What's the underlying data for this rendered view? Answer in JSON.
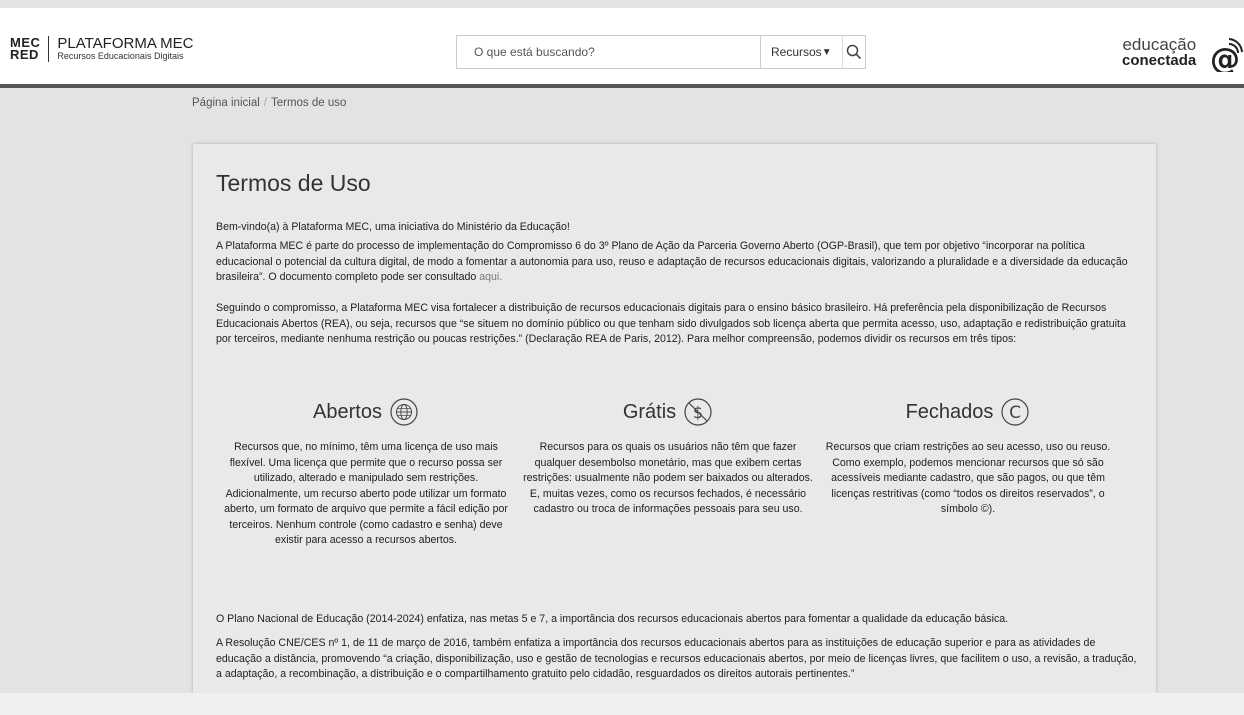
{
  "header": {
    "logo_mark_top": "MEC",
    "logo_mark_bottom": "RED",
    "logo_title": "PLATAFORMA MEC",
    "logo_subtitle": "Recursos Educacionais Digitais",
    "search": {
      "placeholder": "O que está buscando?",
      "category": "Recursos"
    },
    "brand_line1": "educação",
    "brand_line2": "conectada"
  },
  "breadcrumb": {
    "home": "Página inicial",
    "separator": "/",
    "current": "Termos de uso"
  },
  "page": {
    "title": "Termos de Uso",
    "p1": "Bem-vindo(a) à Plataforma MEC, uma iniciativa do Ministério da Educação!",
    "p2": "A Plataforma MEC é parte do processo de implementação do Compromisso 6 do 3º Plano de Ação da Parceria Governo Aberto (OGP-Brasil), que tem por objetivo “incorporar na política educacional o potencial da cultura digital, de modo a fomentar a autonomia para uso, reuso e adaptação de recursos educacionais digitais, valorizando a pluralidade e a diversidade da educação brasileira”. O documento completo pode ser consultado",
    "p2_link": "aqui.",
    "p3": "Seguindo o compromisso, a Plataforma MEC visa fortalecer a distribuição de recursos educacionais digitais para o ensino básico brasileiro. Há preferência pela disponibilização de Recursos Educacionais Abertos (REA), ou seja, recursos que “se situem no domínio público ou que tenham sido divulgados sob licença aberta que permita acesso, uso, adaptação e redistribuição gratuita por terceiros, mediante nenhuma restrição ou poucas restrições.” (Declaração REA de Paris, 2012). Para melhor compreensão, podemos dividir os recursos em três tipos:",
    "types": [
      {
        "title": "Abertos",
        "icon": "globe-icon",
        "text": "Recursos que, no mínimo, têm uma licença de uso mais flexível. Uma licença que permite que o recurso possa ser utilizado, alterado e manipulado sem restrições. Adicionalmente, um recurso aberto pode utilizar um formato aberto, um formato de arquivo que permite a fácil edição por terceiros. Nenhum controle (como cadastro e senha) deve existir para acesso a recursos abertos."
      },
      {
        "title": "Grátis",
        "icon": "no-dollar-icon",
        "text": "Recursos para os quais os usuários não têm que fazer qualquer desembolso monetário, mas que exibem certas restrições: usualmente não podem ser baixados ou alterados. E, muitas vezes, como os recursos fechados, é necessário cadastro ou troca de informações pessoais para seu uso."
      },
      {
        "title": "Fechados",
        "icon": "copyright-icon",
        "text": "Recursos que criam restrições ao seu acesso, uso ou reuso. Como exemplo, podemos mencionar recursos que só são acessíveis mediante cadastro, que são pagos, ou que têm licenças restritivas (como “todos os direitos reservados”, o símbolo ©)."
      }
    ],
    "p4": "O Plano Nacional de Educação (2014-2024) enfatiza, nas metas 5 e 7, a importância dos recursos educacionais abertos para fomentar a qualidade da educação básica.",
    "p5": "A Resolução CNE/CES nº 1, de 11 de março de 2016, também enfatiza a importância dos recursos educacionais abertos para as instituições de educação superior e para as atividades de educação a distância, promovendo “a criação, disponibilização, uso e gestão de tecnologias e recursos educacionais abertos, por meio de licenças livres, que facilitem o uso, a revisão, a tradução, a adaptação, a recombinação, a distribuição e o compartilhamento gratuito pelo cidadão, resguardados os direitos autorais pertinentes.”"
  }
}
